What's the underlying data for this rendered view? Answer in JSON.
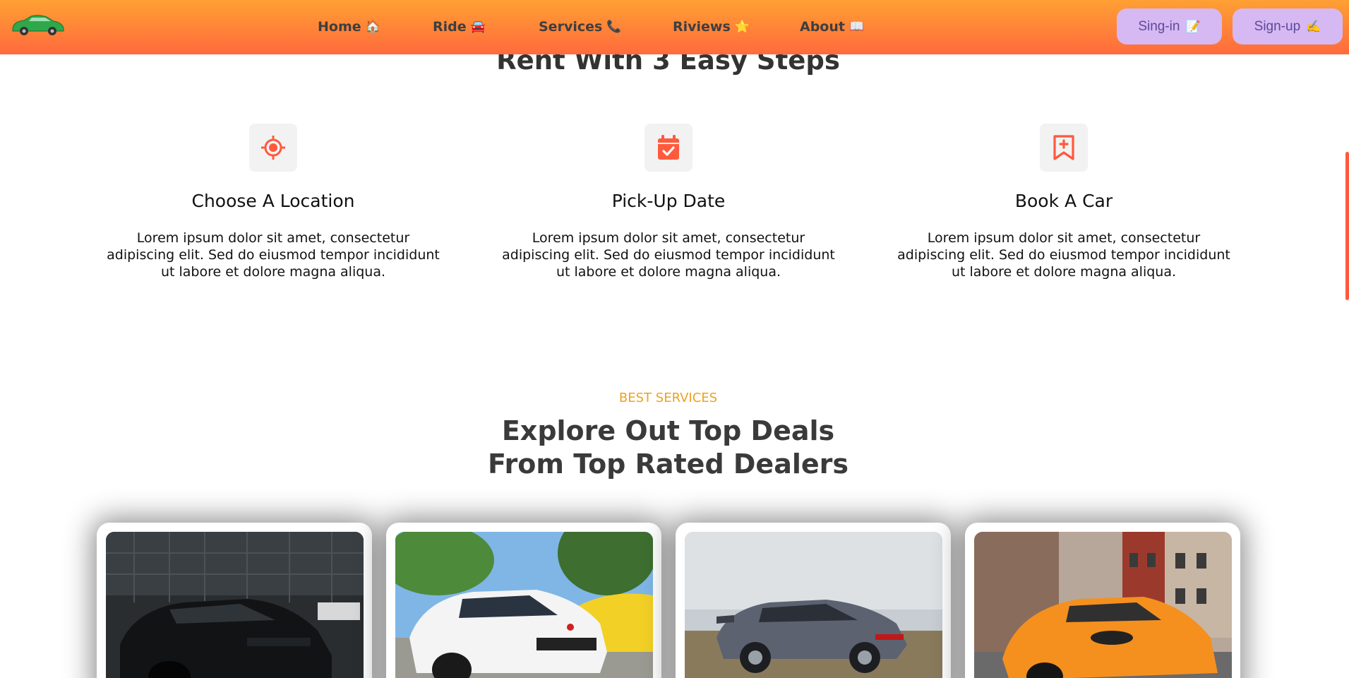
{
  "header": {
    "nav": [
      {
        "label": "Home",
        "emoji": "🏠"
      },
      {
        "label": "Ride",
        "emoji": "🚘"
      },
      {
        "label": "Services",
        "emoji": "📞"
      },
      {
        "label": "Riviews",
        "emoji": "⭐"
      },
      {
        "label": "About",
        "emoji": "📖"
      }
    ],
    "signin": {
      "label": "Sing-in",
      "emoji": "📝"
    },
    "signup": {
      "label": "Sign-up",
      "emoji": "✍️"
    }
  },
  "steps": {
    "title": "Rent With 3 Easy Steps",
    "items": [
      {
        "icon": "location-target-icon",
        "title": "Choose A Location",
        "text": "Lorem ipsum dolor sit amet, consectetur adipiscing elit. Sed do eiusmod tempor incididunt ut labore et dolore magna aliqua."
      },
      {
        "icon": "calendar-check-icon",
        "title": "Pick-Up Date",
        "text": "Lorem ipsum dolor sit amet, consectetur adipiscing elit. Sed do eiusmod tempor incididunt ut labore et dolore magna aliqua."
      },
      {
        "icon": "bookmark-plus-icon",
        "title": "Book A Car",
        "text": "Lorem ipsum dolor sit amet, consectetur adipiscing elit. Sed do eiusmod tempor incididunt ut labore et dolore magna aliqua."
      }
    ]
  },
  "deals": {
    "eyebrow": "BEST SERVICES",
    "title_line1": "Explore Out Top Deals",
    "title_line2": "From Top Rated Dealers",
    "cards": [
      {
        "image": "black-car-photo"
      },
      {
        "image": "white-car-photo"
      },
      {
        "image": "grey-car-photo"
      },
      {
        "image": "orange-car-photo"
      }
    ]
  },
  "colors": {
    "header_top": "#ffa033",
    "header_bottom": "#ff6a3d",
    "auth_button_bg": "#d6b8f3",
    "icon_accent": "#ff5a3c",
    "eyebrow": "#f0a020"
  }
}
